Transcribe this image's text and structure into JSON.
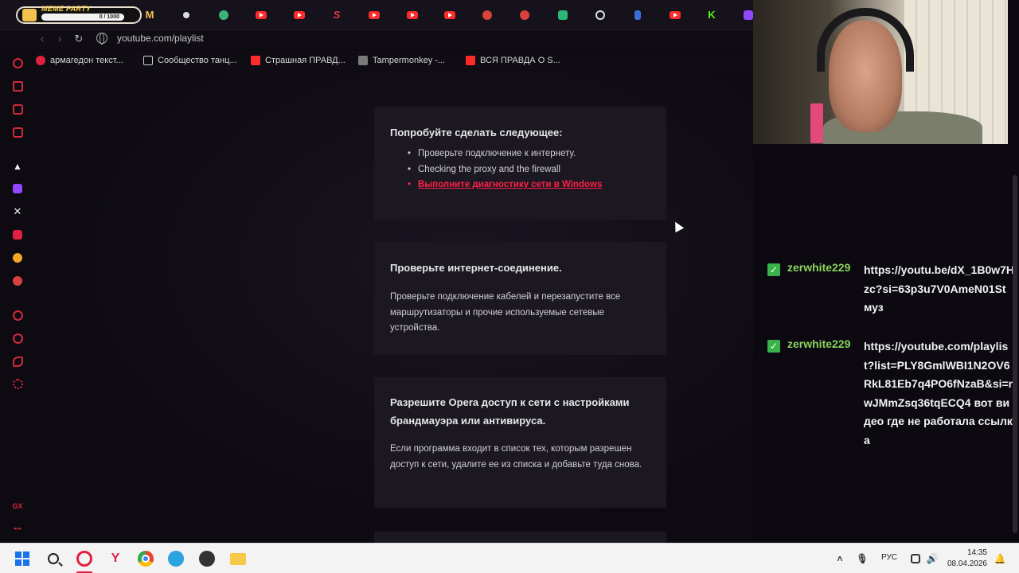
{
  "browser": {
    "first_tab": {
      "title": "MEME PARTY",
      "progress_text": "0 / 1000"
    },
    "address": {
      "url": "youtube.com/playlist"
    },
    "bookmarks": [
      {
        "label": "армагедон текст...",
        "icon_color": "#e02040"
      },
      {
        "label": "Сообщество танц...",
        "icon_color": "#cfcfcf"
      },
      {
        "label": "Страшная ПРАВД...",
        "icon_color": "#ff2a2a"
      },
      {
        "label": "Tampermonkey -...",
        "icon_color": "#7a7a7a"
      },
      {
        "label": "ВСЯ ПРАВДА О S...",
        "icon_color": "#ff2a2a"
      }
    ]
  },
  "error_page": {
    "card1": {
      "title": "Попробуйте сделать следующее:",
      "items": [
        "Проверьте подключение к интернету.",
        "Checking the proxy and the firewall",
        "Выполните диагностику сети в Windows"
      ]
    },
    "card2": {
      "title": "Проверьте интернет-соединение.",
      "body": "Проверьте подключение кабелей и перезапустите все маршрутизаторы и прочие используемые сетевые устройства."
    },
    "card3": {
      "title": "Разрешите Opera доступ к сети с настройками брандмауэра или антивируса.",
      "body": "Если программа входит в список тех, которым разрешен доступ к сети, удалите ее из списка и добавьте туда снова."
    }
  },
  "chat": {
    "messages": [
      {
        "user": "zerwhite229",
        "text": "https://youtu.be/dX_1B0w7Hzc?si=63p3u7V0AmeN01St муз"
      },
      {
        "user": "zerwhite229",
        "text": "https://youtube.com/playlist?list=PLY8GmlWBI1N2OV6RkL81Eb7q4PO6fNzaB&si=rwJMmZsq36tqECQ4 вот видео где не работала ссылка"
      }
    ]
  },
  "sidebar": {
    "gx_label": "GX",
    "more_label": "•••"
  },
  "taskbar": {
    "language": "РУС",
    "time": "14:35",
    "date": "08.04.2026"
  },
  "colors": {
    "accent": "#ff2048",
    "chat_user": "#8bd35c",
    "page_bg": "#0c0a10",
    "card_bg": "#1c1822"
  }
}
